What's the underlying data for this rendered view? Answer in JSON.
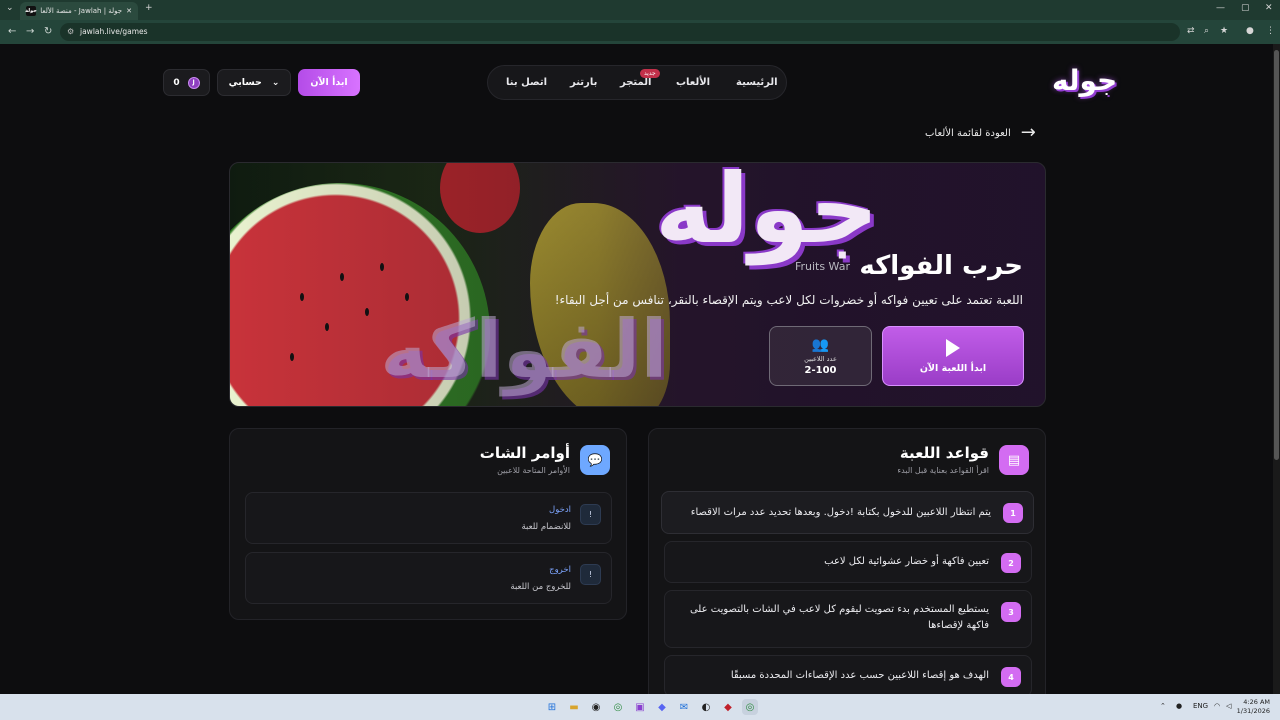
{
  "browser": {
    "tab_title": "جولة | Jawlah - منصة الألعاب الـ",
    "tab_favicon": "جولة",
    "url": "jawlah.live/games"
  },
  "header": {
    "logo": "جوله",
    "nav": [
      "الرئيسية",
      "الألعاب",
      "المتجر",
      "بارتنر",
      "اتصل بنا"
    ],
    "store_badge": "جديد",
    "start_button": "ابدأ الآن",
    "account_button": "حسابي",
    "coins": "0",
    "coin_symbol": "J"
  },
  "back_link": "العودة لقائمة الألعاب",
  "hero": {
    "title": "حرب الفواكه",
    "subtitle": "Fruits War",
    "description": "اللعبة تعتمد على تعيين فواكه أو خضروات لكل لاعب ويتم الإقصاء بالنقر، تنافس من أجل البقاء!",
    "play_label": "ابدأ اللعبة الآن",
    "players_label": "عدد اللاعبين",
    "players_value": "2-100",
    "watermark_top": "جوله",
    "watermark_bottom": "الفواكه"
  },
  "rules": {
    "title": "قواعد اللعبة",
    "subtitle": "اقرأ القواعد بعناية قبل البدء",
    "items": [
      {
        "num": "1",
        "text": "يتم انتظار اللاعبين للدخول بكتابة !دخول. وبعدها تحديد عدد مرات الاقصاء"
      },
      {
        "num": "2",
        "text": "تعيين فاكهة أو خضار عشوائية لكل لاعب"
      },
      {
        "num": "3",
        "text": "يستطيع المستخدم بدء تصويت ليقوم كل لاعب في الشات بالتصويت على فاكهة لإقصاءها"
      },
      {
        "num": "4",
        "text": "الهدف هو إقصاء اللاعبين حسب عدد الإقصاءات المحددة مسبقًا"
      }
    ]
  },
  "chat": {
    "title": "أوامر الشات",
    "subtitle": "الأوامر المتاحة للاعبين",
    "commands": [
      {
        "num": "!",
        "name": "ادخول",
        "desc": "للانضمام للعبة"
      },
      {
        "num": "!",
        "name": "اخروج",
        "desc": "للخروج من اللعبة"
      }
    ]
  },
  "taskbar": {
    "lang": "ENG",
    "time": "4:26 AM",
    "date": "1/31/2026"
  },
  "colors": {
    "accent": "#c15de8",
    "background": "#0d0d0f",
    "card": "#141416",
    "command_name": "#7ea6ff"
  }
}
